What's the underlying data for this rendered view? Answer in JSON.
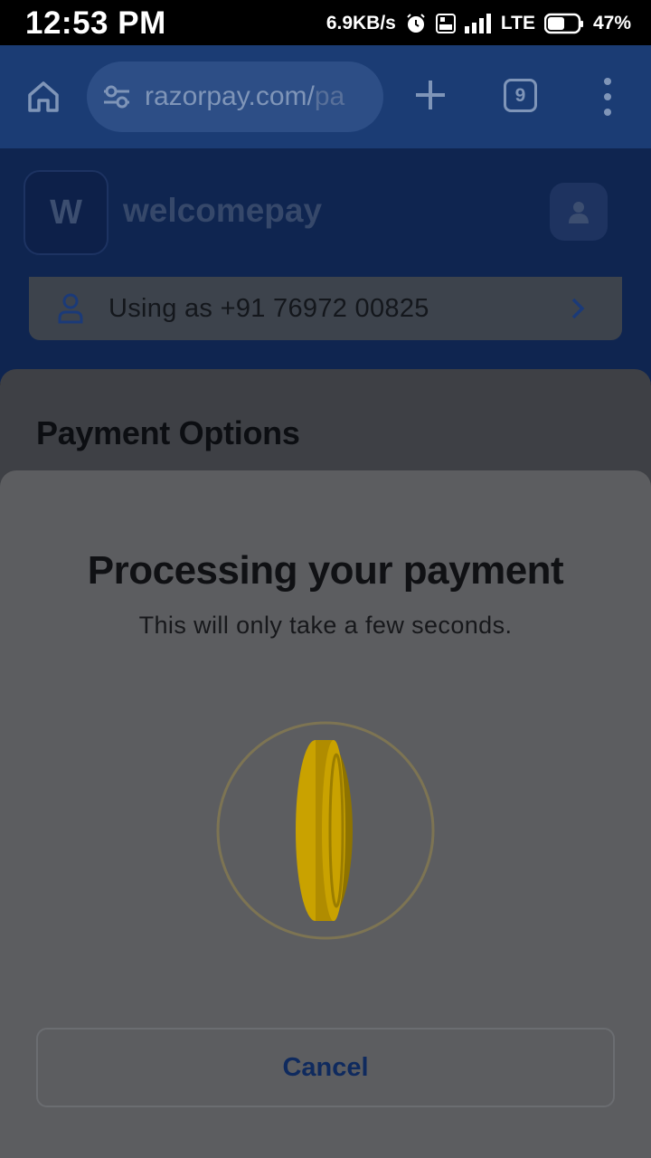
{
  "status_bar": {
    "time": "12:53 PM",
    "net_speed": "6.9KB/s",
    "network": "LTE",
    "battery": "47%",
    "icons": [
      "alarm-icon",
      "volte-icon",
      "signal-icon",
      "battery-icon"
    ]
  },
  "browser": {
    "url_main": "razorpay.com/",
    "url_rest": "pa",
    "tab_count": "9",
    "icons": [
      "home-icon",
      "site-settings-icon",
      "new-tab-plus-icon",
      "tabs-icon",
      "overflow-menu-icon"
    ]
  },
  "merchant": {
    "logo_letter": "W",
    "name": "welcomepay",
    "using_as": "Using as +91 76972 00825"
  },
  "payment_options": {
    "title": "Payment Options"
  },
  "processing": {
    "title": "Processing your payment",
    "subtitle": "This will only take a few seconds.",
    "cancel_label": "Cancel"
  },
  "colors": {
    "browser_bar": "#1b3c74",
    "coin": "#c9a200",
    "cancel_text": "#0f2a5e"
  }
}
